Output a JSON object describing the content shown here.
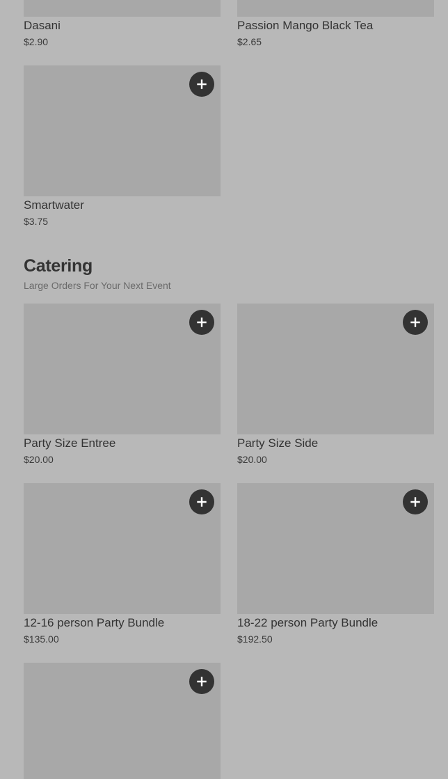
{
  "colors": {
    "background": "#b8b8b8",
    "image_placeholder": "#a8a8a8",
    "add_button": "#333333",
    "text_primary": "#333333",
    "text_secondary": "#6a6a6a"
  },
  "icons": {
    "add": "plus-icon"
  },
  "beverages": {
    "items": [
      {
        "name": "Dasani",
        "price": "$2.90"
      },
      {
        "name": "Passion Mango Black Tea",
        "price": "$2.65"
      },
      {
        "name": "Smartwater",
        "price": "$3.75"
      }
    ]
  },
  "catering": {
    "title": "Catering",
    "subtitle": "Large Orders For Your Next Event",
    "items": [
      {
        "name": "Party Size Entree",
        "price": "$20.00"
      },
      {
        "name": "Party Size Side",
        "price": "$20.00"
      },
      {
        "name": "12-16 person Party Bundle",
        "price": "$135.00"
      },
      {
        "name": "18-22 person Party Bundle",
        "price": "$192.50"
      },
      {
        "name": "",
        "price": ""
      }
    ]
  }
}
